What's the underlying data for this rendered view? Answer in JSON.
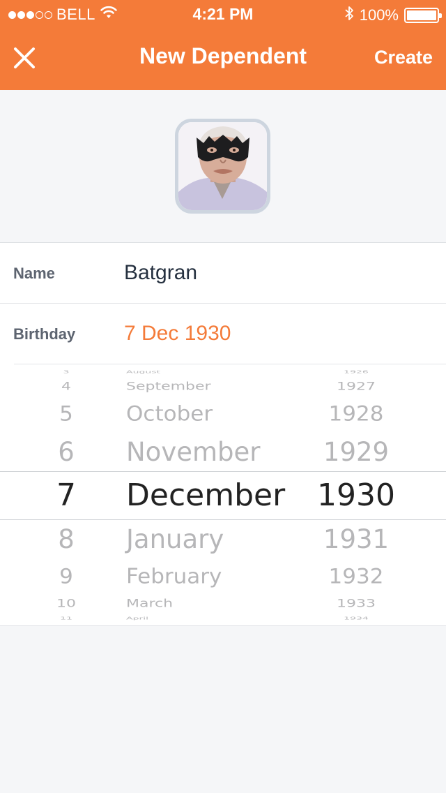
{
  "status_bar": {
    "carrier": "BELL",
    "time": "4:21 PM",
    "battery": "100%",
    "battery_level": 1.0,
    "signal_bars": 3,
    "signal_total": 5
  },
  "nav": {
    "title": "New Dependent",
    "create_label": "Create",
    "close_icon": "close-icon"
  },
  "form": {
    "name_label": "Name",
    "name_value": "Batgran",
    "birthday_label": "Birthday",
    "birthday_value": "7 Dec 1930"
  },
  "picker": {
    "days": [
      "3",
      "4",
      "5",
      "6",
      "7",
      "8",
      "9",
      "10",
      "11"
    ],
    "months": [
      "August",
      "September",
      "October",
      "November",
      "December",
      "January",
      "February",
      "March",
      "April"
    ],
    "years": [
      "1926",
      "1927",
      "1928",
      "1929",
      "1930",
      "1931",
      "1932",
      "1933",
      "1934"
    ],
    "selected_index": 4
  },
  "colors": {
    "accent": "#f47b39",
    "background": "#f5f6f8",
    "text_dark": "#263140",
    "label": "#5d6470"
  }
}
